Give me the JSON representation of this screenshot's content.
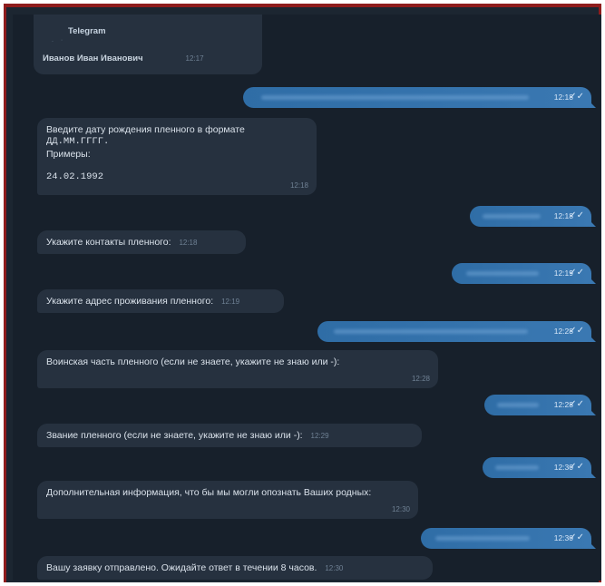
{
  "bot": {
    "header_title": "Telegram",
    "sender_name": "Иванов Иван Иванович",
    "sender_time": "12:17"
  },
  "messages": [
    {
      "dir": "out",
      "time": "12:18"
    },
    {
      "dir": "in",
      "lines": [
        "Введите дату рождения пленного в формате",
        "ДД.ММ.ГГГГ.",
        "Примеры:",
        "",
        "24.02.1992"
      ],
      "time": "12:18"
    },
    {
      "dir": "out",
      "time": "12:18"
    },
    {
      "dir": "in",
      "text": "Укажите контакты пленного:",
      "time": "12:18"
    },
    {
      "dir": "out",
      "time": "12:19"
    },
    {
      "dir": "in",
      "text": "Укажите адрес проживания пленного:",
      "time": "12:19"
    },
    {
      "dir": "out",
      "time": "12:28"
    },
    {
      "dir": "in",
      "text": "Воинская часть пленного (если не знаете, укажите не  знаю или -):",
      "time": "12:28"
    },
    {
      "dir": "out",
      "time": "12:28"
    },
    {
      "dir": "in",
      "text": "Звание пленного (если не знаете, укажите не  знаю или -):",
      "time": "12:29"
    },
    {
      "dir": "out",
      "time": "12:30"
    },
    {
      "dir": "in",
      "text": "Дополнительная информация, что бы мы могли опознать Ваших родных:",
      "time": "12:30"
    },
    {
      "dir": "out",
      "time": "12:30"
    },
    {
      "dir": "in",
      "text": "Вашу заявку отправлено. Ожидайте ответ в течении 8 часов.",
      "time": "12:30"
    }
  ],
  "icons": {
    "read_receipt": "double-check-icon"
  }
}
